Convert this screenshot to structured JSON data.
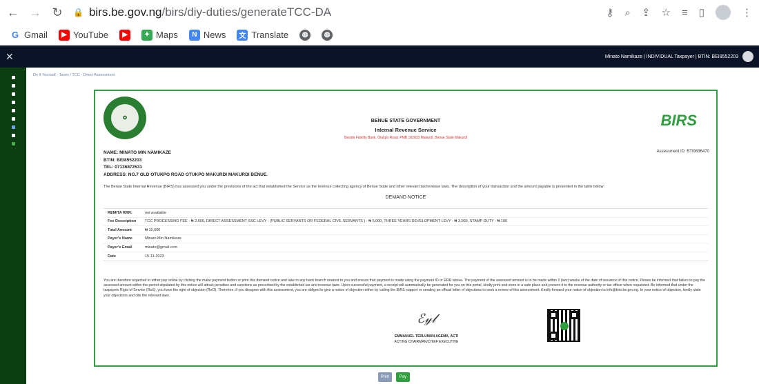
{
  "browser": {
    "url_host": "birs.be.gov.ng",
    "url_path": "/birs/diy-duties/generateTCC-DA"
  },
  "bookmarks": [
    "Gmail",
    "YouTube",
    "Maps",
    "News",
    "Translate"
  ],
  "topbar": {
    "close": "✕",
    "user": "Minato Namikaze | INDIVIDUAL Taxpayer | BTIN: BEI8552203"
  },
  "breadcrumb": "Do It Yourself - Taxes / TCC - Direct Assessment",
  "doc": {
    "gov": "BENUE STATE GOVERNMENT",
    "service": "Internal Revenue Service",
    "address_line": "Beside Fidelity Bank, Otukpo Road, PMB 102023 Makurdi, Benue State Makurdi",
    "name": "NAME: MINATO MIN NAMIKAZE",
    "btin": "BTIN: BEI8552203",
    "tel": "TEL: 07136872531",
    "address": "ADDRESS: NO.7 OLD OTUKPO ROAD OTUKPO MAKURDI MAKURDI BENUE.",
    "assessment_id": "Assessment ID: BTI9836470",
    "intro": "The Benue State Internal Revenue (BIRS) has assessed you under the provisions of the act that established the Service as the revenue collecting agency of Benue State and other relevant tax/revenue laws. The description of your transaction and the amount payable is presented in the table below:",
    "notice_title": "DEMAND NOTICE",
    "rows": [
      {
        "k": "REMITA RRR:",
        "v": "not available"
      },
      {
        "k": "Fee Description",
        "v": "TCC PROCESSING FEE - ₦ 2,500, DIRECT ASSESSMENT SSC LEVY - (PUBLIC SERVANTS OR FEDERAL CIVIL SERVANTS ) - ₦ 5,000, THREE YEARS DEVELOPMENT LEVY - ₦ 3,000, STAMP DUTY - ₦ 100"
      },
      {
        "k": "Total Amount",
        "v": "₦ 10,600"
      },
      {
        "k": "Payer's Name",
        "v": "Minato Min Namikaze"
      },
      {
        "k": "Payer's Email",
        "v": "minato@gmail.com"
      },
      {
        "k": "Date",
        "v": "15-11-2023"
      }
    ],
    "paragraph": "You are therefore expected to either pay online by clicking the make payment button or print this demand notice and take to any bank branch nearest to you and ensure that payment is made using the payment ID or RRR above. The payment of the assessed amount is to be made within 2 (two) weeks of the date of issuance of this notice. Please be informed that failure to pay the assessed amount within the period stipulated by this notice will attract penalties and sanctions as prescribed by the established tax and revenue laws. Upon successful payment, a receipt will automatically be generated for you on this portal, kindly print and store in a safe place and present it to the revenue authority or tax officer when requested. Be informed that under the taxpayers Right of Service (RoS), you have the right of objection (RoO). Therefore, if you disagree with this assessment, you are obliged to give a notice of objection either by calling the BIRS support or sending an official letter of objections to seek a review of this assessment. Kindly forward your notice of objection to info@birs.be.gov.ng. In your notice of objection, kindly state your objections and cite the relevant laws.",
    "signer_name": "EMMANUEL TERLUMUN AGEMA, ACTI",
    "signer_title": "ACTING CHAIRMAN/CHIEF EXECUTIVE"
  },
  "buttons": {
    "print": "Print",
    "pay": "Pay"
  }
}
